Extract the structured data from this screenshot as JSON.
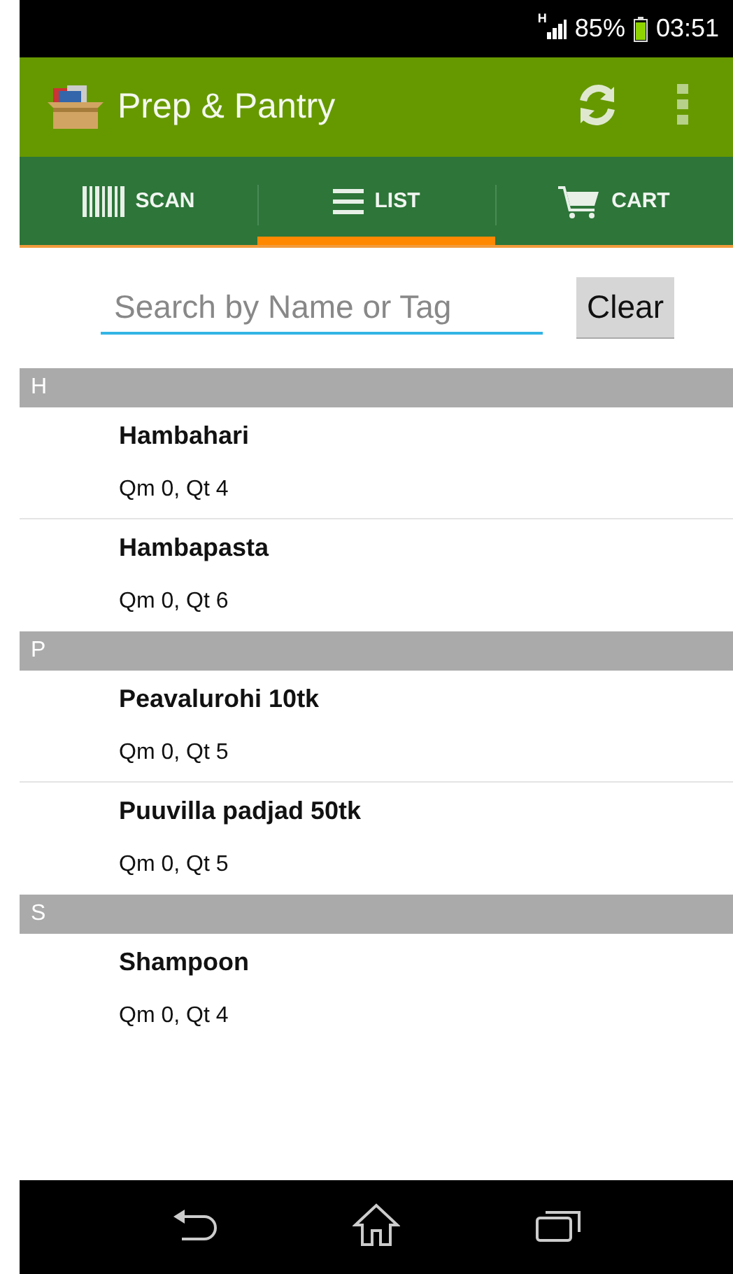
{
  "status_bar": {
    "network": "H",
    "battery": "85%",
    "time": "03:51"
  },
  "app_bar": {
    "title": "Prep & Pantry"
  },
  "tabs": [
    {
      "kind": "barcode",
      "label": "SCAN",
      "selected": false
    },
    {
      "kind": "list",
      "label": "LIST",
      "selected": true
    },
    {
      "kind": "cart",
      "label": "CART",
      "selected": false
    }
  ],
  "search": {
    "placeholder": "Search by Name or Tag",
    "button": "Clear"
  },
  "sections": [
    {
      "header": "H",
      "items": [
        {
          "name": "Hambahari",
          "quantities": "Qm 0, Qt 4"
        },
        {
          "name": "Hambapasta",
          "quantities": "Qm 0, Qt 6"
        }
      ]
    },
    {
      "header": "P",
      "items": [
        {
          "name": "Peavalurohi 10tk",
          "quantities": "Qm 0, Qt 5"
        },
        {
          "name": "Puuvilla padjad 50tk",
          "quantities": "Qm 0, Qt 5"
        }
      ]
    },
    {
      "header": "S",
      "items": [
        {
          "name": "Shampoon",
          "quantities": "Qm 0, Qt 4"
        }
      ]
    }
  ]
}
